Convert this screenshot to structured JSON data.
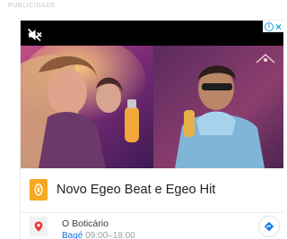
{
  "publicidade_label": "PUBLICIDADE",
  "ad": {
    "title": "Novo Egeo Beat e Egeo Hit",
    "store_name": "O Boticário",
    "store_city": "Bagé",
    "store_hours": "09:00–18:00"
  },
  "colors": {
    "accent_blue": "#1a73e8",
    "adchoices_blue": "#1aa3e0",
    "brand_orange": "#f6a824",
    "pin_red": "#e53935"
  },
  "icons": {
    "mute": "muted-speaker-icon",
    "info": "info-icon",
    "close": "close-icon",
    "brand": "boticario-logo",
    "pin": "location-pin-icon",
    "directions": "directions-icon"
  }
}
